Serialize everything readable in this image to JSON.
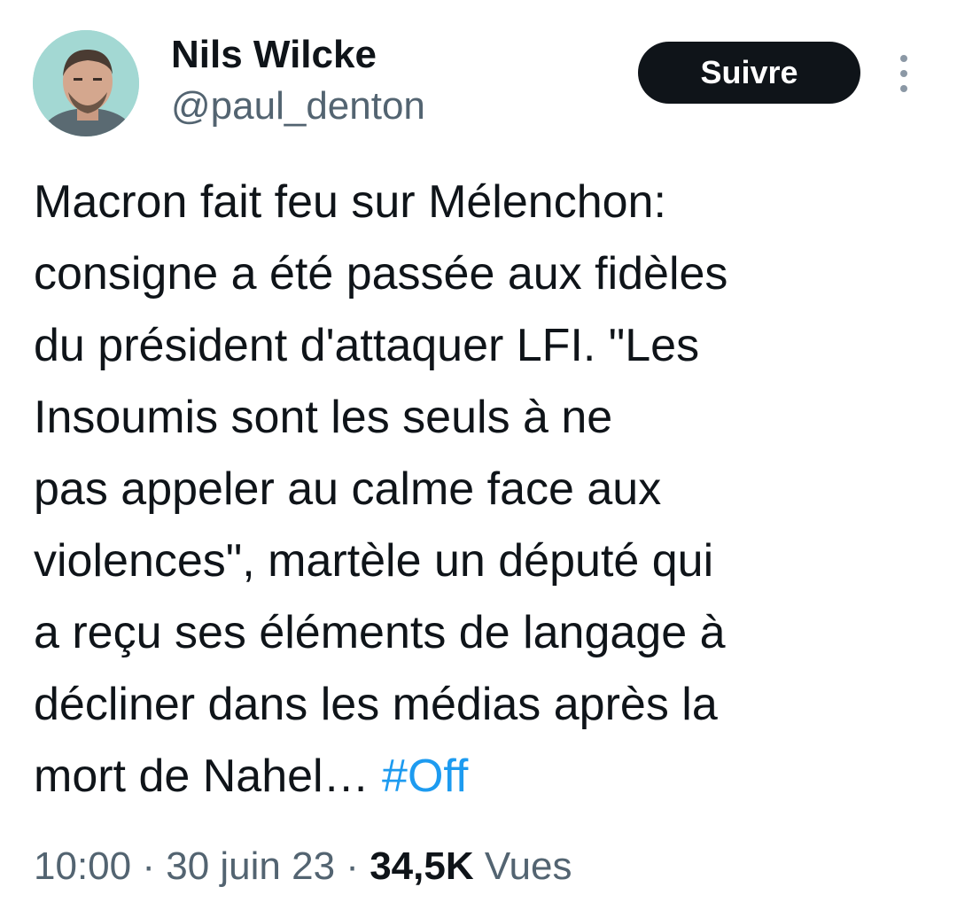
{
  "author": {
    "name": "Nils Wilcke",
    "handle": "@paul_denton"
  },
  "follow_button": {
    "label": "Suivre"
  },
  "icons": {
    "more": "more-vertical-icon",
    "avatar": "profile-photo"
  },
  "tweet": {
    "lines": [
      "Macron fait feu sur Mélenchon:",
      "consigne a été passée aux fidèles",
      "du président d'attaquer LFI. \"Les",
      "Insoumis sont les seuls à ne",
      "pas appeler au calme face aux",
      "violences\", martèle un député qui",
      "a reçu ses éléments de langage à",
      "décliner dans les médias après la"
    ],
    "last_line_text": "mort de Nahel… ",
    "hashtag": "#Off"
  },
  "meta": {
    "time": "10:00",
    "separator": "·",
    "date": "30 juin 23",
    "views_count": "34,5K",
    "views_label": "Vues"
  },
  "colors": {
    "text": "#0f1419",
    "secondary": "#536471",
    "link": "#1d9bf0",
    "button_bg": "#0f1419",
    "button_text": "#ffffff"
  }
}
